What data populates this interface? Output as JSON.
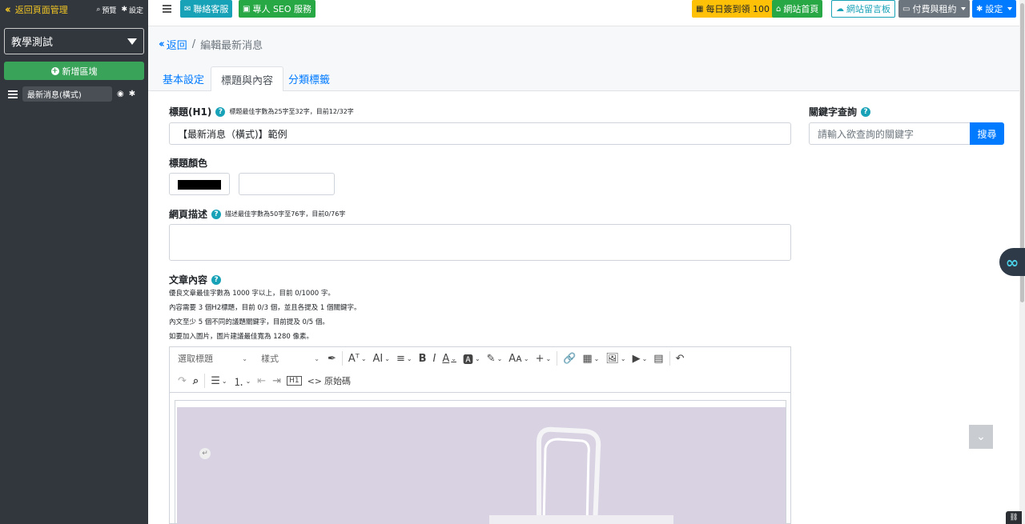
{
  "sidebar": {
    "back_label": "返回頁面管理",
    "preview_label": "預覽",
    "settings_label": "設定",
    "site_select": "教學測試",
    "add_block_label": "新增區塊",
    "block_item_label": "最新消息(橫式)"
  },
  "topbar": {
    "contact_label": "聯絡客服",
    "seo_label": "專人 SEO 服務",
    "checkin_label": "每日簽到領 100",
    "home_label": "網站首頁",
    "guestbook_label": "網站留言板",
    "billing_label": "付費與租約",
    "settings_label": "設定"
  },
  "breadcrumb": {
    "back_label": "返回",
    "separator": "/",
    "current": "編輯最新消息"
  },
  "tabs": [
    {
      "label": "基本設定"
    },
    {
      "label": "標題與內容"
    },
    {
      "label": "分類標籤"
    }
  ],
  "form": {
    "title_label": "標題(H1)",
    "title_hint": "標題最佳字數為25字至32字，目前12/32字",
    "title_value": "【最新消息（橫式)】範例",
    "color_label": "標題顏色",
    "color_value": "#000000",
    "color_text_value": "",
    "desc_label": "網頁描述",
    "desc_hint": "描述最佳字數為50字至76字，目前0/76字",
    "desc_value": "",
    "content_label": "文章內容",
    "notes": [
      "優良文章最佳字數為 1000 字以上，目前 0/1000 字。",
      "內容需要 3 個H2標題，目前 0/3 個，並且各提及 1 個關鍵字。",
      "內文至少 5 個不同的議題關鍵字，目前提及 0/5 個。",
      "如要加入圖片，圖片建議最佳寬為 1280 像素。"
    ]
  },
  "keyword": {
    "label": "關鍵字查詢",
    "placeholder": "請輸入欲查詢的關鍵字",
    "button_label": "搜尋"
  },
  "editor": {
    "heading_select": "選取標題",
    "style_select": "樣式",
    "source_label": "原始碼"
  },
  "colors": {
    "sidebar_bg": "#32373d",
    "accent_yellow": "#f3c623",
    "primary": "#007bff",
    "teal": "#17a2b8",
    "green": "#28a745"
  }
}
